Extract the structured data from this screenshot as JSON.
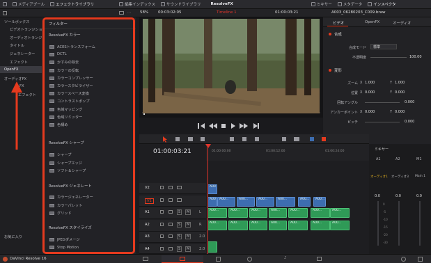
{
  "topbar": {
    "media_pool": "メディアプール",
    "effects_library": "エフェクトライブラリ",
    "edit_index": "編集インデックス",
    "sound_library": "サウンドライブラリ",
    "project": "ResolveFX",
    "mixer": "ミキサー",
    "metadata": "メタデータ",
    "inspector": "インスペクタ"
  },
  "viewer_bar": {
    "zoom": "58%",
    "timecode_left": "00:03:02:05",
    "timeline_name": "Timeline 1",
    "timecode_right": "01:00:03:21",
    "clip_name": "A003_06280203_C009.braw"
  },
  "tool_tree": {
    "toolbox": "ツールボックス",
    "video_transitions": "ビデオトランジショ...",
    "audio_transitions": "オーディオトランジ...",
    "titles": "タイトル",
    "generators": "ジェネレーター",
    "effects": "エフェクト",
    "openfx": "OpenFX",
    "audio_fx": "オーディオFX",
    "ofx_sub": "FX",
    "fairlight": "エフェクト",
    "favorites": "お気に入り"
  },
  "fx_panel": {
    "title": "フィルター",
    "cat1": "ResolveFX カラー",
    "color_items": [
      "ACESトランスフォーム",
      "DCTL",
      "かすみの除去",
      "カラーの反転",
      "カラーコンプレッサー",
      "カラースタビライザー",
      "カラースペース変換",
      "コントラストポップ",
      "色域マッピング",
      "色域リミッター",
      "色構め"
    ],
    "cat2": "ResolveFX シャープ",
    "sharp_items": [
      "シャープ",
      "シャープエッジ",
      "ソフト＆シャープ"
    ],
    "cat3": "ResolveFX ジェネレート",
    "gen_items": [
      "カラージェネレーター",
      "カラーパレット",
      "グリッド"
    ],
    "cat4": "ResolveFX スタイライズ",
    "style_items": [
      "JPEGダメージ",
      "Stop Motion"
    ]
  },
  "inspector": {
    "tabs": [
      "ビデオ",
      "OpenFX",
      "オーディオ"
    ],
    "composite": "合成",
    "composite_mode_label": "合成モード",
    "composite_mode_value": "標準",
    "opacity_label": "不透明度",
    "opacity_value": "100.00",
    "transform": "変形",
    "zoom_label": "ズーム",
    "zoom_x": "1.000",
    "zoom_y": "1.000",
    "position_label": "位置",
    "position_x": "0.000",
    "position_y": "0.000",
    "rotation_label": "回転アングル",
    "rotation_value": "0.000",
    "anchor_label": "アンカーポイント",
    "anchor_x": "0.000",
    "anchor_y": "0.000",
    "pitch_label": "ピッチ",
    "pitch_value": "0.000",
    "x": "X",
    "y": "Y"
  },
  "timeline": {
    "timecode": "01:00:03:21",
    "ruler": [
      "01:00:00:00",
      "01:00:12:00",
      "01:00:24:00"
    ],
    "tracks": [
      {
        "id": "V2"
      },
      {
        "id": "V1"
      },
      {
        "id": "A1",
        "ch": "L"
      },
      {
        "id": "A2",
        "ch": "R"
      },
      {
        "id": "A3",
        "ch": "2.0"
      },
      {
        "id": "A4",
        "ch": "2.0"
      }
    ],
    "clip_label": "A00...",
    "clip_short": "A00",
    "solo": "S",
    "mute": "M",
    "fx": "fx"
  },
  "mixer": {
    "title": "ミキサー",
    "channels": [
      "A1",
      "A2",
      "M1"
    ],
    "audio_labels": [
      "オーディオ1",
      "オーディオ3",
      "Main 1"
    ],
    "db": [
      "0.0",
      "0.0",
      "0.0"
    ],
    "scale": [
      "0",
      "-5",
      "-10",
      "-15",
      "-20",
      "-30"
    ]
  },
  "bottombar": {
    "app_name": "DaVinci Resolve 16"
  },
  "colors": {
    "accent": "#e53a1e",
    "video_clip": "#3d6db0",
    "audio_clip": "#2f9a57",
    "playhead": "#e0352b"
  }
}
